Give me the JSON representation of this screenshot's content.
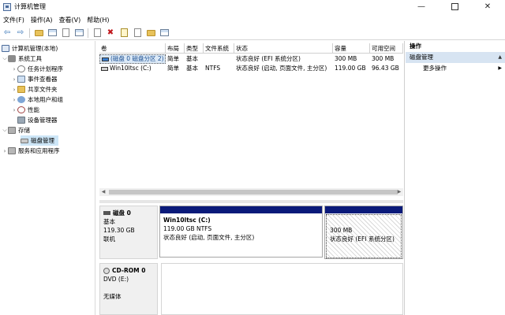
{
  "window": {
    "title": "计算机管理",
    "minimize": "—",
    "close": "✕"
  },
  "menu": [
    "文件(F)",
    "操作(A)",
    "查看(V)",
    "帮助(H)"
  ],
  "toolbar": {
    "back": "⇦",
    "forward": "⇨",
    "delete": "✖"
  },
  "tree": {
    "root": "计算机管理(本地)",
    "system_tools": "系统工具",
    "task_scheduler": "任务计划程序",
    "event_viewer": "事件查看器",
    "shared_folders": "共享文件夹",
    "local_users": "本地用户和组",
    "performance": "性能",
    "device_manager": "设备管理器",
    "storage": "存储",
    "disk_management": "磁盘管理",
    "services": "服务和应用程序"
  },
  "volume_table": {
    "columns": [
      "卷",
      "布局",
      "类型",
      "文件系统",
      "状态",
      "容量",
      "可用空间"
    ],
    "rows": [
      [
        "(磁盘 0 磁盘分区 2)",
        "简单",
        "基本",
        "",
        "状态良好 (EFI 系统分区)",
        "300 MB",
        "300 MB"
      ],
      [
        "Win10ltsc (C:)",
        "简单",
        "基本",
        "NTFS",
        "状态良好 (启动, 页面文件, 主分区)",
        "119.00 GB",
        "96.43 GB"
      ]
    ]
  },
  "disks": {
    "disk0": {
      "name": "磁盘 0",
      "type": "基本",
      "size": "119.30 GB",
      "status": "联机"
    },
    "partition_c": {
      "name": "Win10ltsc  (C:)",
      "size": "119.00 GB NTFS",
      "status": "状态良好 (启动, 页面文件, 主分区)"
    },
    "partition_efi": {
      "size": "300 MB",
      "status": "状态良好 (EFI 系统分区)"
    },
    "cdrom": {
      "name": "CD-ROM 0",
      "type": "DVD (E:)",
      "status": "无媒体"
    }
  },
  "actions": {
    "title": "操作",
    "section": "磁盘管理",
    "more": "更多操作"
  },
  "colors": {
    "partition_bar": "#0a1a7a",
    "selection": "#cde6f7",
    "actions_header": "#d7e4f2"
  }
}
